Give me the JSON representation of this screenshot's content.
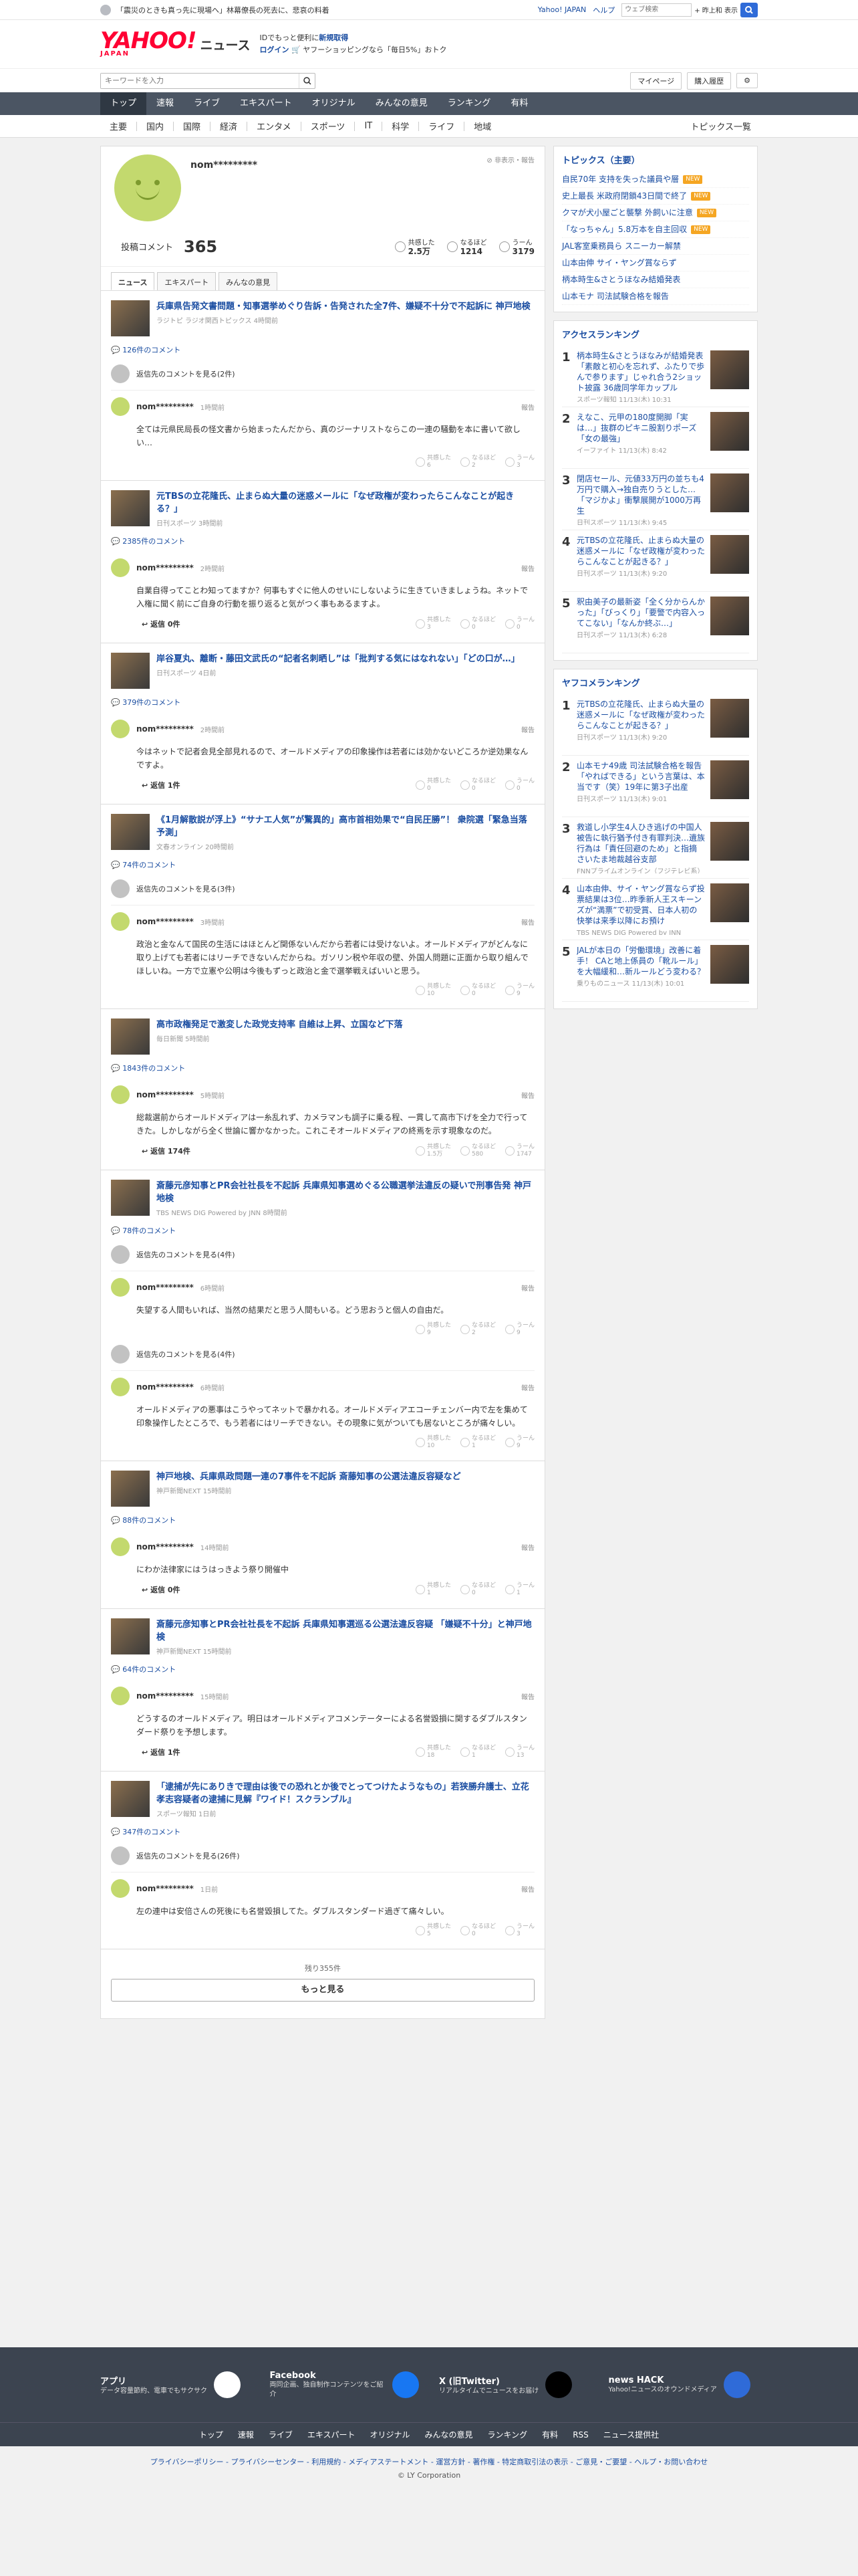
{
  "topbar": {
    "notice": "「震災のときも真っ先に現場へ」林幕僚長の死去に、悲哀の料着",
    "links": [
      "Yahoo! JAPAN",
      "ヘルプ"
    ],
    "search_placeholder": "ウェブ検索",
    "option": "+ 昨上和 表示"
  },
  "header": {
    "logo": "YAHOO!",
    "logo_sub": "JAPAN",
    "section": "ニュース",
    "promo1": "IDでもっと便利に",
    "promo1_link": "新規取得",
    "promo2_link": "ログイン",
    "promo2": "ヤフーショッピングなら「毎日5%」おトク"
  },
  "search": {
    "placeholder": "キーワードを入力",
    "mypage": "マイページ",
    "history": "購入履歴"
  },
  "nav": [
    "トップ",
    "速報",
    "ライブ",
    "エキスパート",
    "オリジナル",
    "みんなの意見",
    "ランキング",
    "有料"
  ],
  "subnav": [
    "主要",
    "国内",
    "国際",
    "経済",
    "エンタメ",
    "スポーツ",
    "IT",
    "科学",
    "ライフ",
    "地域"
  ],
  "subnav_right": "トピックス一覧",
  "profile": {
    "name": "nom*********",
    "hidden_label": "非表示・報告",
    "comment_label": "投稿コメント",
    "comment_count": "365",
    "reactions": [
      {
        "label": "共感した",
        "value": "2.5万"
      },
      {
        "label": "なるほど",
        "value": "1214"
      },
      {
        "label": "うーん",
        "value": "3179"
      }
    ]
  },
  "tabs": [
    "ニュース",
    "エキスパート",
    "みんなの意見"
  ],
  "articles": [
    {
      "title": "兵庫県告発文書問題・知事選挙めぐり告訴・告発された全7件、嫌疑不十分で不起訴に 神戸地検",
      "source": "ラジトピ ラジオ関西トピックス 4時間前",
      "count": "126件のコメント",
      "reply_more": "返信先のコメントを見る(2件)",
      "comments": [
        {
          "user": "nom*********",
          "time": "1時間前",
          "body": "全ては元県民局長の怪文書から始まったんだから、真のジーナリストならこの一連の騒動を本に書いて欲しい…",
          "votes": [
            "6",
            "2",
            "3"
          ],
          "reply": ""
        }
      ]
    },
    {
      "title": "元TBSの立花隆氏、止まらぬ大量の迷惑メールに「なぜ政権が変わったらこんなことが起きる？」",
      "source": "日刊スポーツ 3時間前",
      "count": "2385件のコメント",
      "reply_more": "",
      "comments": [
        {
          "user": "nom*********",
          "time": "2時間前",
          "body": "自業自得ってことわ知ってますか？何事もすぐに他人のせいにしないように生きていきましょうね。ネットで入権に聞く前にご自身の行動を振り返ると気がつく事もあるますよ。",
          "votes": [
            "3",
            "0",
            "0"
          ],
          "reply": "返信 0件"
        }
      ]
    },
    {
      "title": "岸谷夏丸、離断・藤田文武氏の“記者名刺晒し”は「批判する気にはなれない」「どの口が…」",
      "source": "日刊スポーツ 4日前",
      "count": "379件のコメント",
      "reply_more": "",
      "comments": [
        {
          "user": "nom*********",
          "time": "2時間前",
          "body": "今はネットで記者会見全部見れるので、オールドメディアの印象操作は若者には効かないどころか逆効果なんですよ。",
          "votes": [
            "0",
            "0",
            "0"
          ],
          "reply": "返信 1件"
        }
      ]
    },
    {
      "title": "《1月解散説が浮上》“サナエ人気”が驚異的」高市首相効果で“自民圧勝”！ 衆院選「緊急当落予測」",
      "source": "文春オンライン 20時間前",
      "count": "74件のコメント",
      "reply_more": "返信先のコメントを見る(3件)",
      "comments": [
        {
          "user": "nom*********",
          "time": "3時間前",
          "body": "政治と金なんて国民の生活にはほとんど関係ないんだから若者には受けないよ。オールドメディアがどんなに取り上げても若者にはリーチできないんだからね。ガソリン税や年収の壁、外国人問題に正面から取り組んでほしいね。一方で立憲や公明は今後もずっと政治と金で選挙戦えばいいと思う。",
          "votes": [
            "10",
            "0",
            "9"
          ],
          "reply": ""
        }
      ]
    },
    {
      "title": "高市政権発足で激変した政党支持率 自維は上昇、立国など下落",
      "source": "毎日新聞 5時間前",
      "count": "1843件のコメント",
      "reply_more": "",
      "comments": [
        {
          "user": "nom*********",
          "time": "5時間前",
          "body": "総裁選前からオールドメディアは一糸乱れず、カメラマンも調子に乗る程、一貫して高市下げを全力で行ってきた。しかしながら全く世論に響かなかった。これこそオールドメディアの終焉を示す現象なのだ。",
          "votes": [
            "1.5万",
            "580",
            "1747"
          ],
          "reply": "返信 174件"
        }
      ]
    },
    {
      "title": "斎藤元彦知事とPR会社社長を不起訴 兵庫県知事選めぐる公職選挙法違反の疑いで刑事告発 神戸地検",
      "source": "TBS NEWS DIG Powered by JNN 8時間前",
      "count": "78件のコメント",
      "reply_more": "返信先のコメントを見る(4件)",
      "comments": [
        {
          "user": "nom*********",
          "time": "6時間前",
          "body": "失望する人間もいれば、当然の結果だと思う人間もいる。どう思おうと個人の自由だ。",
          "votes": [
            "9",
            "2",
            "9"
          ],
          "reply": ""
        },
        {
          "user": "nom*********",
          "time": "6時間前",
          "body": "オールドメディアの悪事はこうやってネットで暴かれる。オールドメディアエコーチェンバー内で左を集めて印象操作したところで、もう若者にはリーチできない。その現象に気がついても居ないところが痛々しい。",
          "votes": [
            "10",
            "1",
            "9"
          ],
          "reply": "",
          "pre": "返信先のコメントを見る(4件)"
        }
      ]
    },
    {
      "title": "神戸地検、兵庫県政問題一連の7事件を不起訴 斎藤知事の公選法違反容疑など",
      "source": "神戸新聞NEXT 15時間前",
      "count": "88件のコメント",
      "reply_more": "",
      "comments": [
        {
          "user": "nom*********",
          "time": "14時間前",
          "body": "にわか法律家にはうはっきよう祭り開催中",
          "votes": [
            "1",
            "0",
            "1"
          ],
          "reply": "返信 0件"
        }
      ]
    },
    {
      "title": "斎藤元彦知事とPR会社社長を不起訴 兵庫県知事選巡る公選法違反容疑 「嫌疑不十分」と神戸地検",
      "source": "神戸新聞NEXT 15時間前",
      "count": "64件のコメント",
      "reply_more": "",
      "comments": [
        {
          "user": "nom*********",
          "time": "15時間前",
          "body": "どうするのオールドメディア。明日はオールドメディアコメンテーターによる名誉毀損に関するダブルスタンダード祭りを予想します。",
          "votes": [
            "18",
            "1",
            "13"
          ],
          "reply": "返信 1件"
        }
      ]
    },
    {
      "title": "「逮捕が先にありきで理由は後での恐れとか後でとってつけたようなもの」若狭勝弁護士、立花孝志容疑者の逮捕に見解『ワイド！スクランブル』",
      "source": "スポーツ報知 1日前",
      "count": "347件のコメント",
      "reply_more": "返信先のコメントを見る(26件)",
      "comments": [
        {
          "user": "nom*********",
          "time": "1日前",
          "body": "左の連中は安倍さんの死後にも名誉毀損してた。ダブルスタンダード過ぎて痛々しい。",
          "votes": [
            "5",
            "0",
            "3"
          ],
          "reply": ""
        }
      ]
    }
  ],
  "more": {
    "remaining": "残り355件",
    "button": "もっと見る"
  },
  "vote_labels": [
    "共感した",
    "なるほど",
    "うーん"
  ],
  "report_label": "報告",
  "side": {
    "topics_title": "トピックス（主要）",
    "topics": [
      {
        "t": "自民70年 支持を失った議員や層",
        "new": true
      },
      {
        "t": "史上最長 米政府閉鎖43日間で終了",
        "new": true
      },
      {
        "t": "クマが犬小屋ごと襲撃 外飼いに注意",
        "new": true
      },
      {
        "t": "「なっちゃん」5.8万本を自主回収",
        "new": true
      },
      {
        "t": "JAL客室乗務員ら スニーカー解禁",
        "new": false
      },
      {
        "t": "山本由伸 サイ・ヤング賞ならず",
        "new": false
      },
      {
        "t": "柄本時生&さとうほなみ結婚発表",
        "new": false
      },
      {
        "t": "山本モナ 司法試験合格を報告",
        "new": false
      }
    ],
    "access_title": "アクセスランキング",
    "access": [
      {
        "t": "柄本時生&さとうほなみが結婚発表 「素敵と初心を忘れず、ふたりで歩んで参ります」じゃれ合う2ショット披露 36歳同学年カップル",
        "m": "スポーツ報知 11/13(木) 10:31"
      },
      {
        "t": "えなこ、元甲の180度開脚「実は…」抜群のピキニ股割りポーズ「女の最強」",
        "m": "イーファイト 11/13(木) 8:42"
      },
      {
        "t": "閉店セール、元値33万円の並ちも4万円で購入→独自売りうとした…「マジかよ」衝撃展開が1000万再生",
        "m": "日刊スポーツ 11/13(木) 9:45"
      },
      {
        "t": "元TBSの立花隆氏、止まらぬ大量の迷惑メールに「なぜ政権が変わったらこんなことが起きる？」",
        "m": "日刊スポーツ 11/13(木) 9:20"
      },
      {
        "t": "釈由美子の最新姿「全く分からんかった」「びっくり」「要警で内容入ってこない」「なんか終ぶ…」",
        "m": "日刊スポーツ 11/13(木) 6:28"
      }
    ],
    "yahoo_title": "ヤフコメランキング",
    "yahoo": [
      {
        "t": "元TBSの立花隆氏、止まらぬ大量の迷惑メールに「なぜ政権が変わったらこんなことが起きる？」",
        "m": "日刊スポーツ 11/13(木) 9:20"
      },
      {
        "t": "山本モナ49歳 司法試験合格を報告「やればできる」という言葉は、本当です（笑）19年に第3子出産",
        "m": "日刊スポーツ 11/13(木) 9:01"
      },
      {
        "t": "救道し小学生4人ひき逃げの中国人被告に執行猶予付き有罪判決…遺族行為は「責任回避のため」と指摘 さいたま地裁越谷支部",
        "m": "FNNプライムオンライン（フジテレビ系） 11/13(木) 11:30"
      },
      {
        "t": "山本由伸、サイ・ヤング賞ならず投票結果は3位…昨季新人王スキーンズが“満票”で初受賞、日本人初の快挙は来季以降にお預け",
        "m": "TBS NEWS DIG Powered by JNN 11/13(木) 9:55"
      },
      {
        "t": "JALが本日の「労働環境」改善に着手！ CAと地上係員の「靴ルール」を大幅緩和…新ルールどう変わる？",
        "m": "乗りものニュース 11/13(木) 10:01"
      }
    ]
  },
  "footer": {
    "items": [
      {
        "t": "アプリ",
        "d": "データ容量節約、電車でもサクサク"
      },
      {
        "t": "Facebook",
        "d": "両同企画、独自制作コンテンツをご紹介"
      },
      {
        "t": "X (旧Twitter)",
        "d": "リアルタイムでニュースをお届け"
      },
      {
        "t": "news HACK",
        "d": "Yahoo!ニュースのオウンドメディア"
      }
    ],
    "nav": [
      "トップ",
      "速報",
      "ライブ",
      "エキスパート",
      "オリジナル",
      "みんなの意見",
      "ランキング",
      "有料",
      "RSS",
      "ニュース提供社"
    ],
    "links": "プライバシーポリシー - プライバシーセンター - 利用規約 - メディアステートメント - 運営方針 - 著作権 - 特定商取引法の表示 - ご意見・ご要望 - ヘルプ・お問い合わせ",
    "copy": "© LY Corporation"
  },
  "colors": {
    "accent": "#1a4da1",
    "nav": "#4b5563",
    "avatar": "#c3d96e",
    "new_badge": "#f5a623"
  }
}
